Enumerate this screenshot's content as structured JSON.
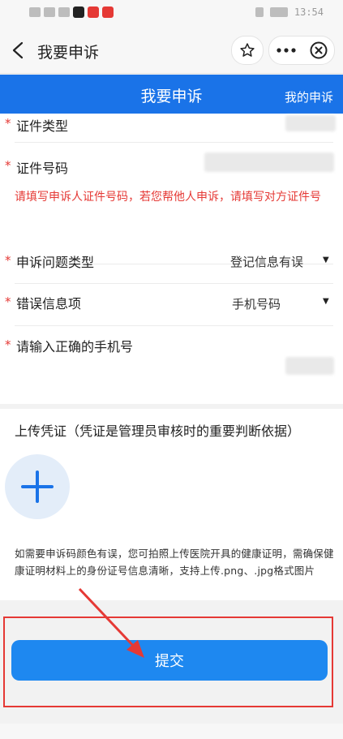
{
  "status_bar": {
    "time": "13:54"
  },
  "nav": {
    "title": "我要申诉"
  },
  "header": {
    "title": "我要申诉",
    "my_appeals": "我的申诉"
  },
  "form": {
    "id_type_label": "证件类型",
    "id_number_label": "证件号码",
    "id_number_hint": "请填写申诉人证件号码，若您帮他人申诉，请填写对方证件号",
    "issue_type_label": "申诉问题类型",
    "issue_type_value": "登记信息有误",
    "error_item_label": "错误信息项",
    "error_item_value": "手机号码",
    "phone_label": "请输入正确的手机号",
    "required_mark": "*"
  },
  "upload": {
    "title": "上传凭证（凭证是管理员审核时的重要判断依据）",
    "note": "如需要申诉码颜色有误，您可拍照上传医院开具的健康证明，需确保健康证明材料上的身份证号信息清晰，支持上传.png、.jpg格式图片"
  },
  "submit": {
    "label": "提交"
  },
  "colors": {
    "primary": "#1a73e8",
    "button": "#1e88f0",
    "required": "#e53935",
    "annotation": "#e53935"
  },
  "icons": [
    "back-icon",
    "star-icon",
    "more-icon",
    "close-circle-icon",
    "plus-icon"
  ]
}
